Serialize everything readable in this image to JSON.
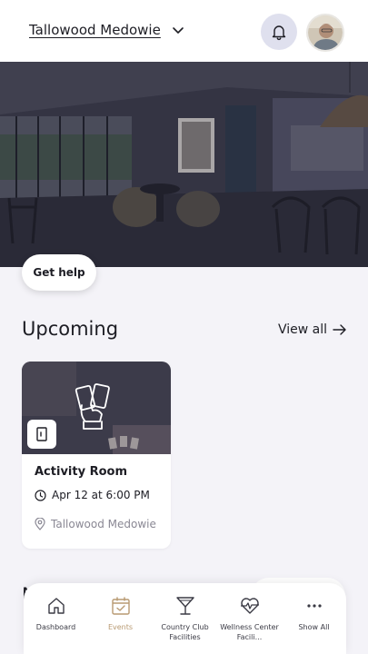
{
  "header": {
    "community_name": "Tallowood Medowie",
    "icons": {
      "dropdown": "chevron-down-icon",
      "notifications": "bell-icon",
      "profile": "avatar"
    }
  },
  "help": {
    "label": "Get help"
  },
  "upcoming": {
    "title": "Upcoming",
    "view_all_label": "View all",
    "events": [
      {
        "title": "Activity Room",
        "datetime": "Apr 12 at 6:00 PM",
        "location": "Tallowood Medowie",
        "badge_icon": "door-icon",
        "image_icon": "playing-cards-icon"
      }
    ]
  },
  "next_section": {
    "title_partial": "N"
  },
  "nav": {
    "items": [
      {
        "label": "Dashboard",
        "icon": "home-icon",
        "active": false
      },
      {
        "label": "Events",
        "icon": "calendar-check-icon",
        "active": true
      },
      {
        "label": "Country Club Facilities",
        "icon": "cocktail-icon",
        "active": false
      },
      {
        "label": "Wellness Center Facili...",
        "icon": "heartbeat-icon",
        "active": false
      },
      {
        "label": "Show All",
        "icon": "more-icon",
        "active": false
      }
    ]
  },
  "colors": {
    "accent": "#b89a72",
    "bell_bg": "#dfe0ee",
    "page_bg": "#f4f3f8"
  }
}
